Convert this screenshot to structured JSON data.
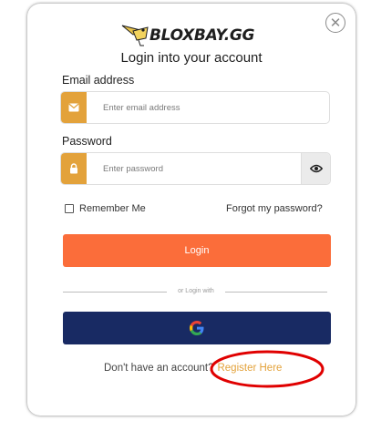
{
  "logo": {
    "text": "BLOXBAY.GG"
  },
  "modal": {
    "title": "Login into your account",
    "close_icon": "close-icon"
  },
  "email": {
    "label": "Email address",
    "placeholder": "Enter email address",
    "value": "",
    "icon": "envelope-icon"
  },
  "password": {
    "label": "Password",
    "placeholder": "Enter password",
    "value": "",
    "icon": "lock-icon",
    "toggle_icon": "eye-icon"
  },
  "remember": {
    "label": "Remember Me",
    "checked": false
  },
  "forgot": {
    "label": "Forgot my password?"
  },
  "login_button": {
    "label": "Login"
  },
  "divider": {
    "text": "or Login with"
  },
  "google_button": {
    "icon": "google-icon"
  },
  "footer": {
    "prompt": "Don't have an account?",
    "register_label": "Register Here"
  },
  "colors": {
    "accent": "#e3a23b",
    "login_button": "#fb6d3a",
    "google_button": "#182a63",
    "annotation": "#e00000"
  }
}
